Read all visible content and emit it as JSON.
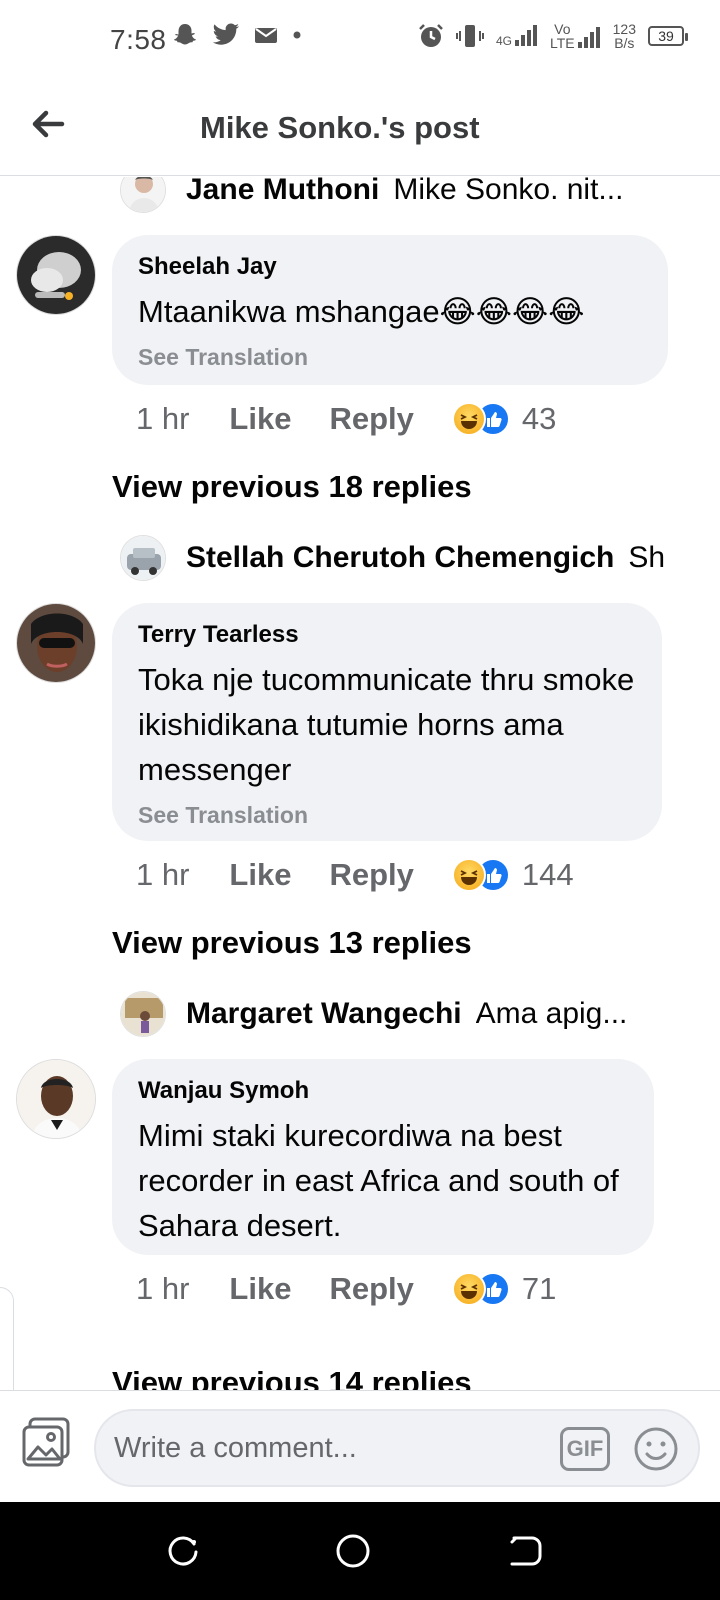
{
  "status_bar": {
    "time": "7:58",
    "net_speed_value": "123",
    "net_speed_unit": "B/s",
    "battery": "39",
    "network_tag": "4G",
    "volte_top": "Vo",
    "volte_bottom": "LTE"
  },
  "header": {
    "title": "Mike Sonko.'s post"
  },
  "threads": [
    {
      "reply_preview": {
        "name": "Jane Muthoni",
        "text": "Mike Sonko. nit..."
      },
      "comment": {
        "author": "Sheelah Jay",
        "text": "Mtaanikwa mshangae😂😂😂😂",
        "see_translation": "See Translation",
        "time": "1 hr",
        "like_label": "Like",
        "reply_label": "Reply",
        "reaction_count": "43"
      },
      "view_previous": "View previous 18 replies"
    },
    {
      "reply_preview": {
        "name": "Stellah Cherutoh Chemengich",
        "text": "Sh"
      },
      "comment": {
        "author": "Terry Tearless",
        "text": "Toka nje tucommunicate thru smoke ikishidikana tutumie horns ama messenger",
        "see_translation": "See Translation",
        "time": "1 hr",
        "like_label": "Like",
        "reply_label": "Reply",
        "reaction_count": "144"
      },
      "view_previous": "View previous 13 replies"
    },
    {
      "reply_preview": {
        "name": "Margaret Wangechi",
        "text": "Ama apig..."
      },
      "comment": {
        "author": "Wanjau Symoh",
        "text": "Mimi staki kurecordiwa na  best recorder in east  Africa and south of Sahara desert.",
        "time": "1 hr",
        "like_label": "Like",
        "reply_label": "Reply",
        "reaction_count": "71"
      },
      "view_previous": "View previous 14 replies"
    }
  ],
  "composer": {
    "placeholder": "Write a comment...",
    "gif_label": "GIF"
  },
  "colors": {
    "bubble": "#f0f2f5",
    "secondary_text": "#65676b",
    "like_blue": "#1877f2",
    "haha_yellow": "#f7b125"
  }
}
